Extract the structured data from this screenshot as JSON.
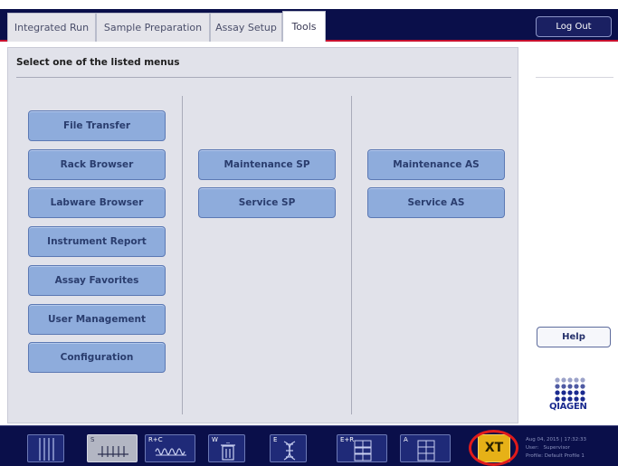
{
  "tabs": [
    {
      "label": "Integrated Run"
    },
    {
      "label": "Sample Preparation"
    },
    {
      "label": "Assay Setup"
    },
    {
      "label": "Tools"
    }
  ],
  "header": {
    "logout_label": "Log Out"
  },
  "main": {
    "title": "Select one of the listed menus",
    "column1": [
      "File Transfer",
      "Rack Browser",
      "Labware Browser",
      "Instrument Report",
      "Assay Favorites",
      "User Management",
      "Configuration"
    ],
    "column2": [
      "Maintenance SP",
      "Service SP"
    ],
    "column3": [
      "Maintenance AS",
      "Service AS"
    ]
  },
  "side": {
    "help_label": "Help",
    "logo_text": "QIAGEN"
  },
  "modules": [
    {
      "letter": "",
      "icon": "rack-icon"
    },
    {
      "letter": "S",
      "icon": "sample-tubes-icon"
    },
    {
      "letter": "R+C",
      "icon": "reagent-tubes-icon"
    },
    {
      "letter": "W",
      "icon": "waste-bin-icon"
    },
    {
      "letter": "E",
      "icon": "dna-icon"
    },
    {
      "letter": "E+R",
      "icon": "eluate-plates-icon"
    },
    {
      "letter": "A",
      "icon": "assay-plate-icon"
    },
    {
      "letter": "XT",
      "icon": "tools-icon"
    }
  ],
  "status": {
    "datetime": "Aug 04, 2015 | 17:32:33",
    "user_label": "User:",
    "user_value": "Supervisor",
    "profile_label": "Profile:",
    "profile_value": "Default Profile 1"
  },
  "colors": {
    "navy": "#0a0f4a",
    "accent_red": "#c8102e",
    "button_blue": "#8eacdc",
    "tools_gold": "#e6b117",
    "highlight_red": "#e01b1b"
  }
}
